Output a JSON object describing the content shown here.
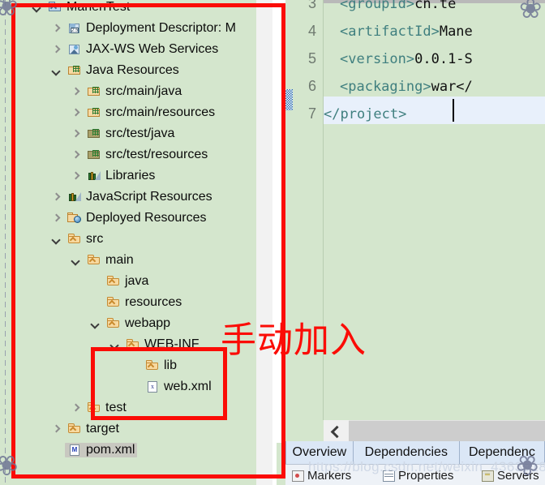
{
  "explorer": {
    "title": "Project Explorer",
    "tree": [
      {
        "label": "ManenTest",
        "icon": "project-folder-icon",
        "depth": 0,
        "twisty": "expanded",
        "selected": false
      },
      {
        "label": "Deployment Descriptor: M",
        "icon": "deployment-descriptor-icon",
        "depth": 1,
        "twisty": "collapsed",
        "selected": false
      },
      {
        "label": "JAX-WS Web Services",
        "icon": "jax-ws-icon",
        "depth": 1,
        "twisty": "collapsed",
        "selected": false
      },
      {
        "label": "Java Resources",
        "icon": "java-resources-icon",
        "depth": 1,
        "twisty": "expanded",
        "selected": false
      },
      {
        "label": "src/main/java",
        "icon": "source-package-icon",
        "depth": 2,
        "twisty": "collapsed",
        "selected": false
      },
      {
        "label": "src/main/resources",
        "icon": "source-package-icon",
        "depth": 2,
        "twisty": "collapsed",
        "selected": false
      },
      {
        "label": "src/test/java",
        "icon": "test-package-icon",
        "depth": 2,
        "twisty": "collapsed",
        "selected": false
      },
      {
        "label": "src/test/resources",
        "icon": "test-package-icon",
        "depth": 2,
        "twisty": "collapsed",
        "selected": false
      },
      {
        "label": "Libraries",
        "icon": "libraries-icon",
        "depth": 2,
        "twisty": "collapsed",
        "selected": false
      },
      {
        "label": "JavaScript Resources",
        "icon": "libraries-icon",
        "depth": 1,
        "twisty": "collapsed",
        "selected": false
      },
      {
        "label": "Deployed Resources",
        "icon": "deployed-resources-icon",
        "depth": 1,
        "twisty": "collapsed",
        "selected": false
      },
      {
        "label": "src",
        "icon": "folder-icon",
        "depth": 1,
        "twisty": "expanded",
        "selected": false
      },
      {
        "label": "main",
        "icon": "folder-icon",
        "depth": 2,
        "twisty": "expanded",
        "selected": false
      },
      {
        "label": "java",
        "icon": "folder-icon",
        "depth": 3,
        "twisty": "none",
        "selected": false
      },
      {
        "label": "resources",
        "icon": "folder-icon",
        "depth": 3,
        "twisty": "none",
        "selected": false
      },
      {
        "label": "webapp",
        "icon": "folder-icon",
        "depth": 3,
        "twisty": "expanded",
        "selected": false
      },
      {
        "label": "WEB-INF",
        "icon": "folder-icon",
        "depth": 4,
        "twisty": "expanded",
        "selected": false
      },
      {
        "label": "lib",
        "icon": "folder-icon",
        "depth": 5,
        "twisty": "none",
        "selected": false
      },
      {
        "label": "web.xml",
        "icon": "xml-file-icon",
        "depth": 5,
        "twisty": "none",
        "selected": false
      },
      {
        "label": "test",
        "icon": "folder-icon",
        "depth": 2,
        "twisty": "collapsed",
        "selected": false
      },
      {
        "label": "target",
        "icon": "folder-icon",
        "depth": 1,
        "twisty": "collapsed",
        "selected": false
      },
      {
        "label": "pom.xml",
        "icon": "maven-pom-icon",
        "depth": 1,
        "twisty": "none",
        "selected": true
      }
    ]
  },
  "editor": {
    "filename": "pom.xml",
    "lines": [
      {
        "num": "3",
        "indent": 2,
        "segments": [
          {
            "t": "tag",
            "v": "<groupId>"
          },
          {
            "t": "txt",
            "v": "cn.te"
          }
        ]
      },
      {
        "num": "4",
        "indent": 2,
        "segments": [
          {
            "t": "tag",
            "v": "<artifactId>"
          },
          {
            "t": "txt",
            "v": "Mane"
          }
        ]
      },
      {
        "num": "5",
        "indent": 2,
        "segments": [
          {
            "t": "tag",
            "v": "<version>"
          },
          {
            "t": "txt",
            "v": "0.0.1-S"
          }
        ]
      },
      {
        "num": "6",
        "indent": 2,
        "segments": [
          {
            "t": "tag",
            "v": "<packaging>"
          },
          {
            "t": "txt",
            "v": "war</"
          }
        ]
      },
      {
        "num": "7",
        "indent": 0,
        "segments": [
          {
            "t": "tag",
            "v": "</project>"
          }
        ]
      }
    ],
    "current_line": "7",
    "form_tabs": [
      "Overview",
      "Dependencies",
      "Dependenc"
    ],
    "hscroll_left_label": "‹"
  },
  "bottom_tabs": [
    {
      "label": "Markers",
      "icon": "markers-icon"
    },
    {
      "label": "Properties",
      "icon": "properties-icon"
    },
    {
      "label": "Servers",
      "icon": "servers-icon"
    }
  ],
  "annotations": {
    "chinese_note": "手动加入",
    "outer_box_color": "#fb0c06",
    "inner_box_color": "#fb0c06"
  },
  "watermark": "https://blog.csdn.net/weixin_4363918",
  "colors": {
    "tree_background": "#d4e6cd",
    "editor_background": "#d4e6cd",
    "xml_tag": "#3f7f7f",
    "selection": "#c8c8c0",
    "current_line": "#e8f0fb",
    "annotation_red": "#fb0c06",
    "form_tab_background": "#dbe7f6"
  }
}
